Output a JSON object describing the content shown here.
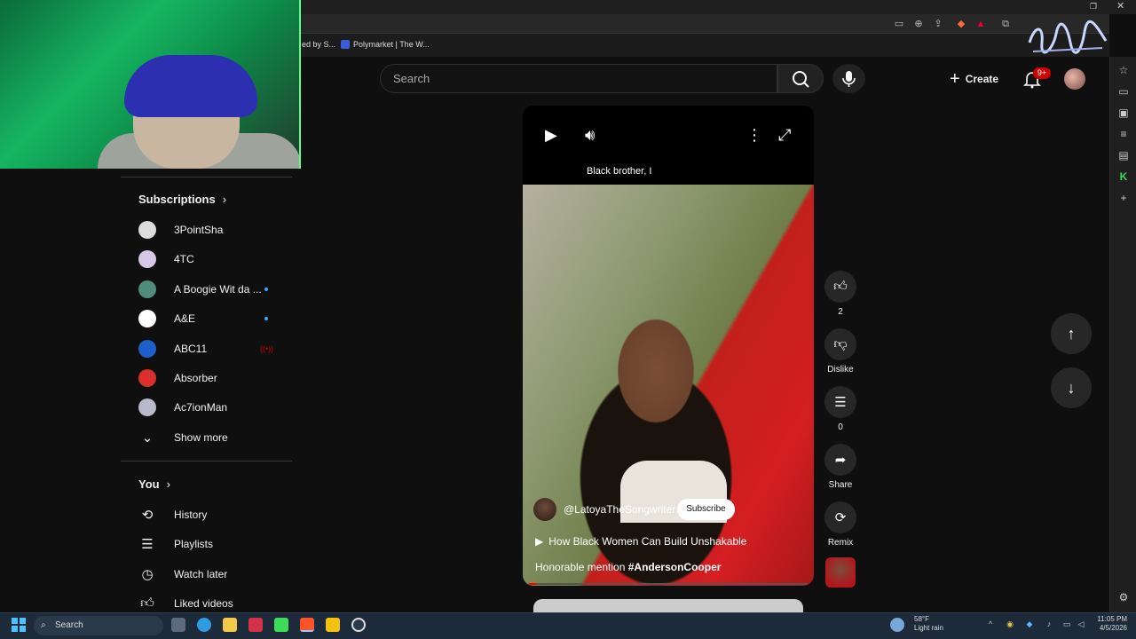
{
  "bookmarks": [
    {
      "label": "ed by S..."
    },
    {
      "label": "Polymarket | The W..."
    }
  ],
  "header": {
    "search_placeholder": "Search",
    "create_label": "Create",
    "notification_count": "9+"
  },
  "sidebar": {
    "subscriptions_title": "Subscriptions",
    "subscriptions": [
      {
        "name": "3PointSha",
        "color": "#dcdcdc",
        "new": false
      },
      {
        "name": "4TC",
        "color": "#d8c8e8",
        "new": false
      },
      {
        "name": "A Boogie Wit da ...",
        "color": "#4f8c7a",
        "new": true
      },
      {
        "name": "A&E",
        "color": "#ffffff",
        "new": true
      },
      {
        "name": "ABC11",
        "color": "#1f5fc9",
        "live": true
      },
      {
        "name": "Absorber",
        "color": "#d9302b",
        "new": false
      },
      {
        "name": "Ac7ionMan",
        "color": "#b9b9c9",
        "new": false
      }
    ],
    "show_more": "Show more",
    "you_title": "You",
    "you_items": [
      {
        "label": "History",
        "icon": "history-icon"
      },
      {
        "label": "Playlists",
        "icon": "playlists-icon"
      },
      {
        "label": "Watch later",
        "icon": "clock-icon"
      },
      {
        "label": "Liked videos",
        "icon": "thumbs-up-icon"
      }
    ]
  },
  "short": {
    "caption": "Black brother, I",
    "channel": "@LatoyaTheSongwriter",
    "subscribe_label": "Subscribe",
    "related_title": "How Black Women Can Build Unshakable",
    "description_prefix": "Honorable mention ",
    "description_tag": "#AndersonCooper",
    "progress": 0.03
  },
  "actions": {
    "like_count": "2",
    "dislike_label": "Dislike",
    "comment_count": "0",
    "share_label": "Share",
    "remix_label": "Remix"
  },
  "taskbar": {
    "search_label": "Search",
    "weather_temp": "58°F",
    "weather_desc": "Light rain",
    "time": "11:05 PM",
    "date": "4/5/2026"
  },
  "colors": {
    "accent_red": "#ff0000",
    "background": "#0f0f0f",
    "link_blue": "#3ea6ff"
  }
}
